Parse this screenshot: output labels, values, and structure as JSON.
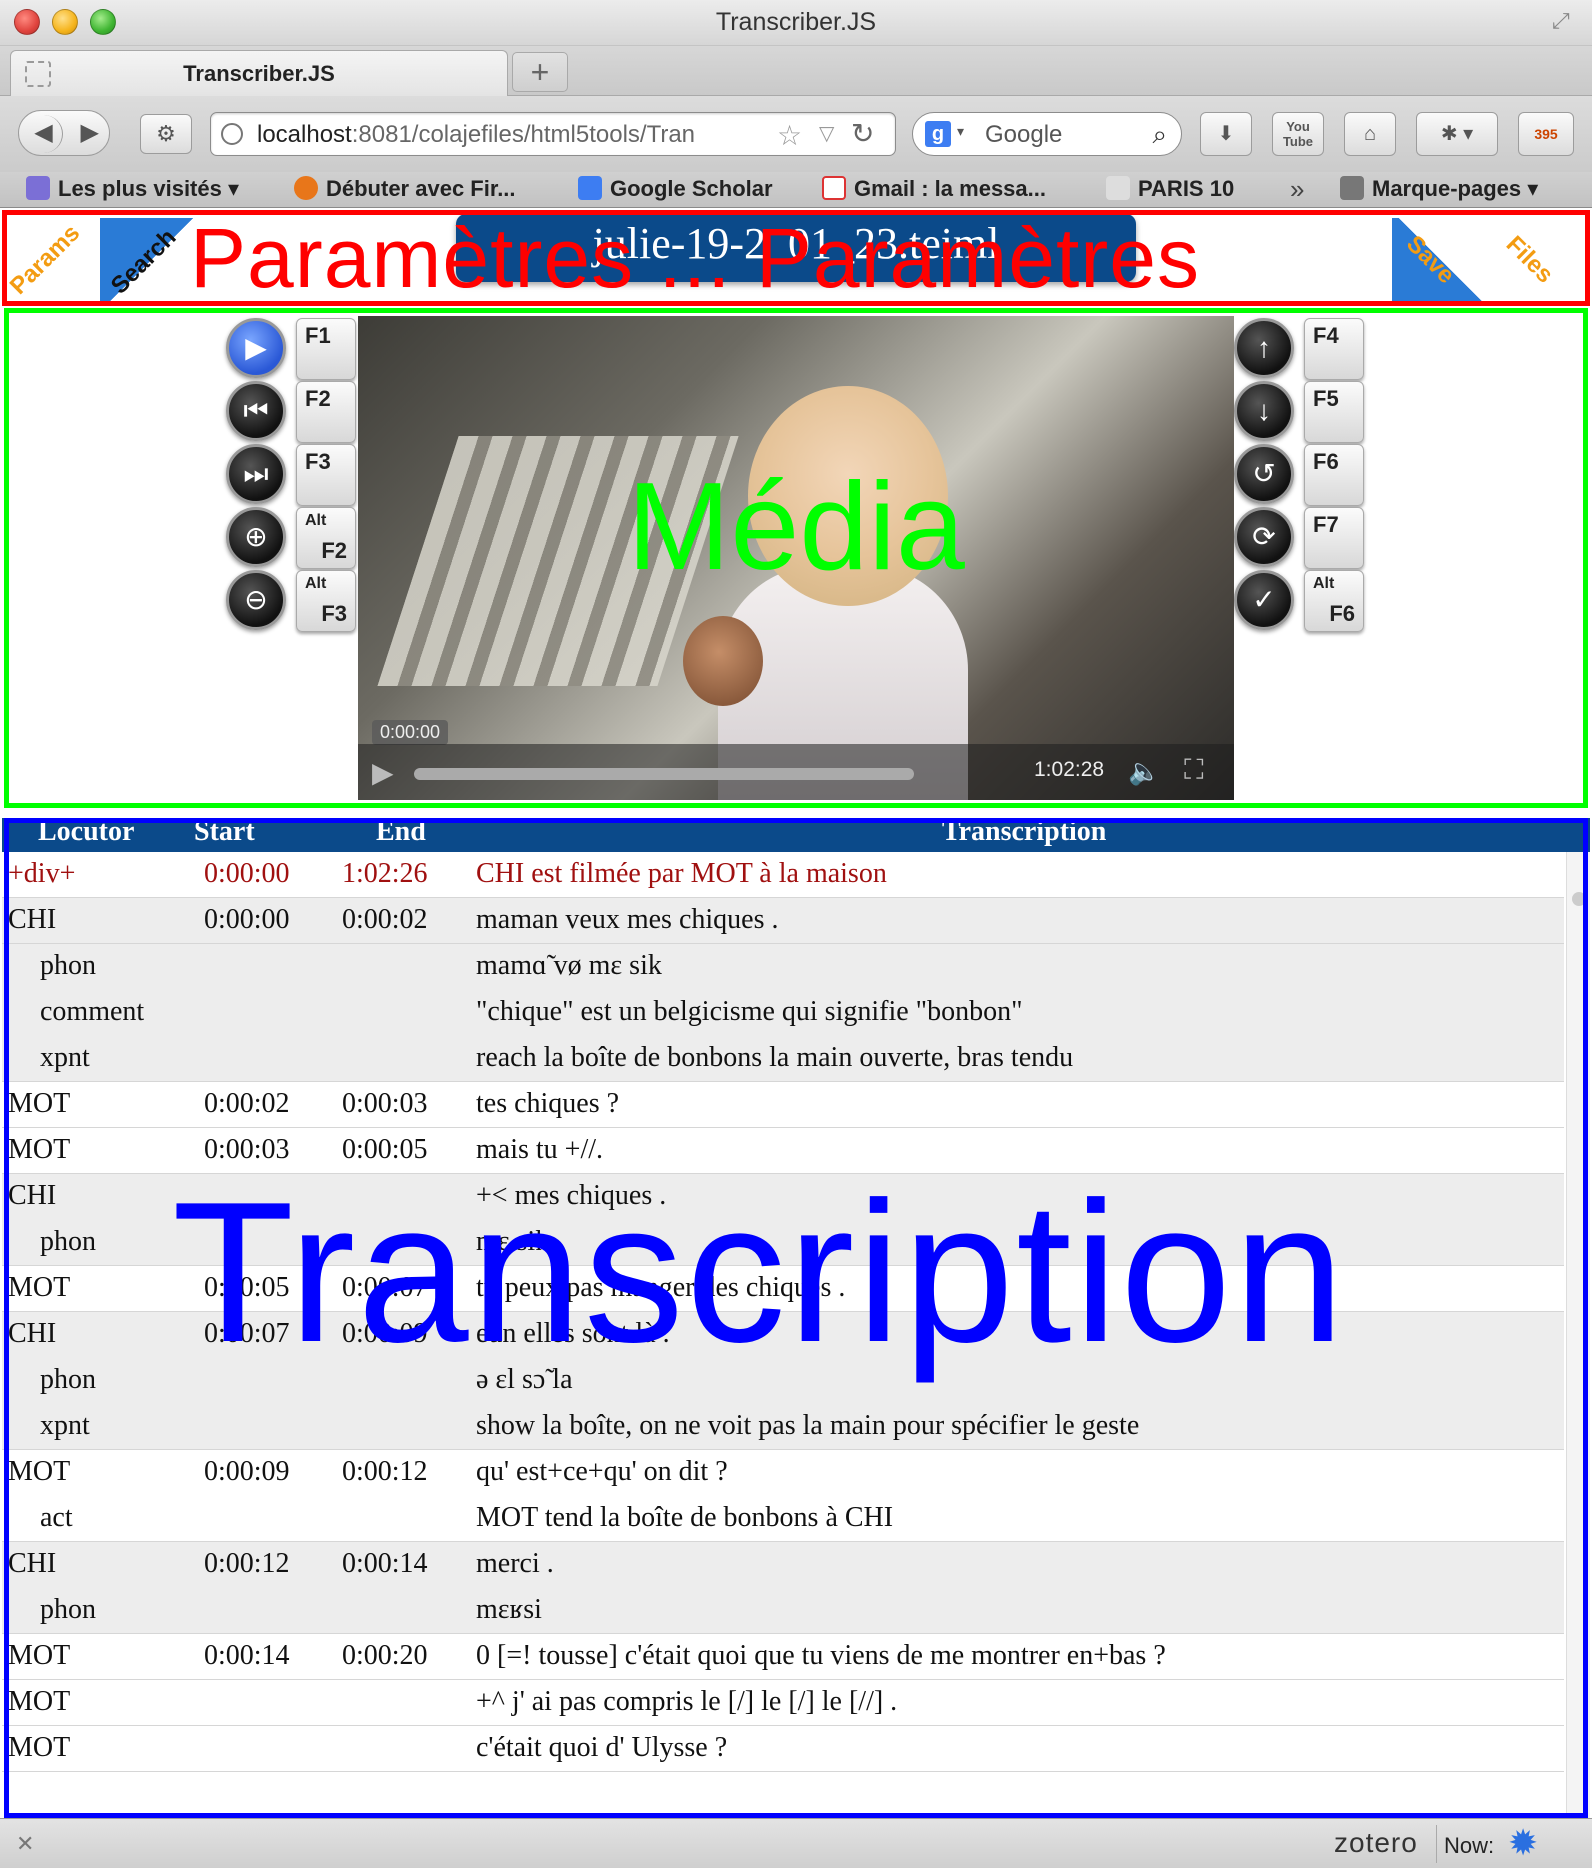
{
  "window": {
    "title": "Transcriber.JS"
  },
  "tabs": [
    {
      "label": "Transcriber.JS"
    }
  ],
  "navbar": {
    "url_host": "localhost",
    "url_rest": ":8081/colajefiles/html5tools/Tran",
    "search_placeholder": "Google",
    "youtube_label": "You Tube",
    "badge_count": "395"
  },
  "bookmarks": [
    {
      "label": "Les plus visités ▾",
      "color": "#7b6fd6"
    },
    {
      "label": "Débuter avec Fir...",
      "color": "#e8761a"
    },
    {
      "label": "Google Scholar",
      "color": "#3d7df2"
    },
    {
      "label": "Gmail : la messa...",
      "color": "#d33"
    },
    {
      "label": "PARIS 10",
      "color": "#444"
    },
    {
      "label": "Marque-pages ▾",
      "color": "#666"
    }
  ],
  "params": {
    "corners": {
      "params": "Params",
      "search": "Search",
      "save": "Save",
      "files": "Files"
    },
    "overlay_label": "Paramètres ... Paramètres",
    "filename": "julie-19-2_01_23.teiml",
    "accent": "#0b4a8a"
  },
  "media": {
    "overlay_label": "Média",
    "left_keys": [
      {
        "icon": "▶",
        "name": "play-icon",
        "alt": "",
        "key": "F1"
      },
      {
        "icon": "⏮",
        "name": "rewind-icon",
        "alt": "",
        "key": "F2"
      },
      {
        "icon": "⏭",
        "name": "fast-forward-icon",
        "alt": "",
        "key": "F3"
      },
      {
        "icon": "⊕",
        "name": "zoom-in-icon",
        "alt": "Alt",
        "key": "F2"
      },
      {
        "icon": "⊖",
        "name": "zoom-out-icon",
        "alt": "Alt",
        "key": "F3"
      }
    ],
    "right_keys": [
      {
        "icon": "↑",
        "name": "arrow-up-icon",
        "alt": "",
        "key": "F4"
      },
      {
        "icon": "↓",
        "name": "arrow-down-icon",
        "alt": "",
        "key": "F5"
      },
      {
        "icon": "↺",
        "name": "replay-icon",
        "alt": "",
        "key": "F6"
      },
      {
        "icon": "⟳",
        "name": "loop-icon",
        "alt": "",
        "key": "F7"
      },
      {
        "icon": "✓",
        "name": "check-icon",
        "alt": "Alt",
        "key": "F6"
      }
    ],
    "current_time": "0:00:00",
    "duration": "1:02:28"
  },
  "transcription": {
    "overlay_label": "Transcription",
    "headers": {
      "locutor": "Locutor",
      "start": "Start",
      "end": "End",
      "transcription": "Transcription"
    },
    "rows": [
      {
        "loc": "+div+",
        "start": "0:00:00",
        "end": "1:02:26",
        "text": "CHI est filmée par MOT à la maison",
        "style": "red",
        "indent": false
      },
      {
        "loc": "CHI",
        "start": "0:00:00",
        "end": "0:00:02",
        "text": "maman veux mes chiques .",
        "style": "grey",
        "indent": false
      },
      {
        "loc": "phon",
        "start": "",
        "end": "",
        "text": "mamɑ̃ vø mɛ sik",
        "style": "grey-sub",
        "indent": true
      },
      {
        "loc": "comment",
        "start": "",
        "end": "",
        "text": "\"chique\" est un belgicisme qui signifie \"bonbon\"",
        "style": "grey-sub",
        "indent": true
      },
      {
        "loc": "xpnt",
        "start": "",
        "end": "",
        "text": "reach la boîte de bonbons la main ouverte, bras tendu",
        "style": "grey",
        "indent": true
      },
      {
        "loc": "MOT",
        "start": "0:00:02",
        "end": "0:00:03",
        "text": "tes chiques ?",
        "style": "white",
        "indent": false
      },
      {
        "loc": "MOT",
        "start": "0:00:03",
        "end": "0:00:05",
        "text": "mais tu +//.",
        "style": "white",
        "indent": false
      },
      {
        "loc": "CHI",
        "start": "",
        "end": "",
        "text": "+< mes chiques .",
        "style": "grey-sub",
        "indent": false
      },
      {
        "loc": "phon",
        "start": "",
        "end": "",
        "text": "mɛ sik",
        "style": "grey",
        "indent": true
      },
      {
        "loc": "MOT",
        "start": "0:00:05",
        "end": "0:00:07",
        "text": "tu peux pas manger des chiques .",
        "style": "white",
        "indent": false
      },
      {
        "loc": "CHI",
        "start": "0:00:07",
        "end": "0:00:09",
        "text": "eun elles sont là .",
        "style": "grey-sub",
        "indent": false
      },
      {
        "loc": "phon",
        "start": "",
        "end": "",
        "text": "ə ɛl sɔ̃ la",
        "style": "grey-sub",
        "indent": true
      },
      {
        "loc": "xpnt",
        "start": "",
        "end": "",
        "text": "show la boîte, on ne voit pas la main pour spécifier le geste",
        "style": "grey",
        "indent": true
      },
      {
        "loc": "MOT",
        "start": "0:00:09",
        "end": "0:00:12",
        "text": "qu' est+ce+qu' on dit ?",
        "style": "white-sub",
        "indent": false
      },
      {
        "loc": "act",
        "start": "",
        "end": "",
        "text": "MOT tend la boîte de bonbons à CHI",
        "style": "white",
        "indent": true
      },
      {
        "loc": "CHI",
        "start": "0:00:12",
        "end": "0:00:14",
        "text": "merci .",
        "style": "grey-sub",
        "indent": false
      },
      {
        "loc": "phon",
        "start": "",
        "end": "",
        "text": "mɛʁsi",
        "style": "grey",
        "indent": true
      },
      {
        "loc": "MOT",
        "start": "0:00:14",
        "end": "0:00:20",
        "text": "0 [=! tousse] c'était quoi que tu viens de me montrer en+bas ?",
        "style": "white",
        "indent": false
      },
      {
        "loc": "MOT",
        "start": "",
        "end": "",
        "text": "+^ j' ai pas compris le [/] le [/] le [//] .",
        "style": "white",
        "indent": false
      },
      {
        "loc": "MOT",
        "start": "",
        "end": "",
        "text": "c'était quoi d' Ulysse ?",
        "style": "white",
        "indent": false
      }
    ]
  },
  "statusbar": {
    "zotero": "zotero",
    "now": "Now:"
  }
}
